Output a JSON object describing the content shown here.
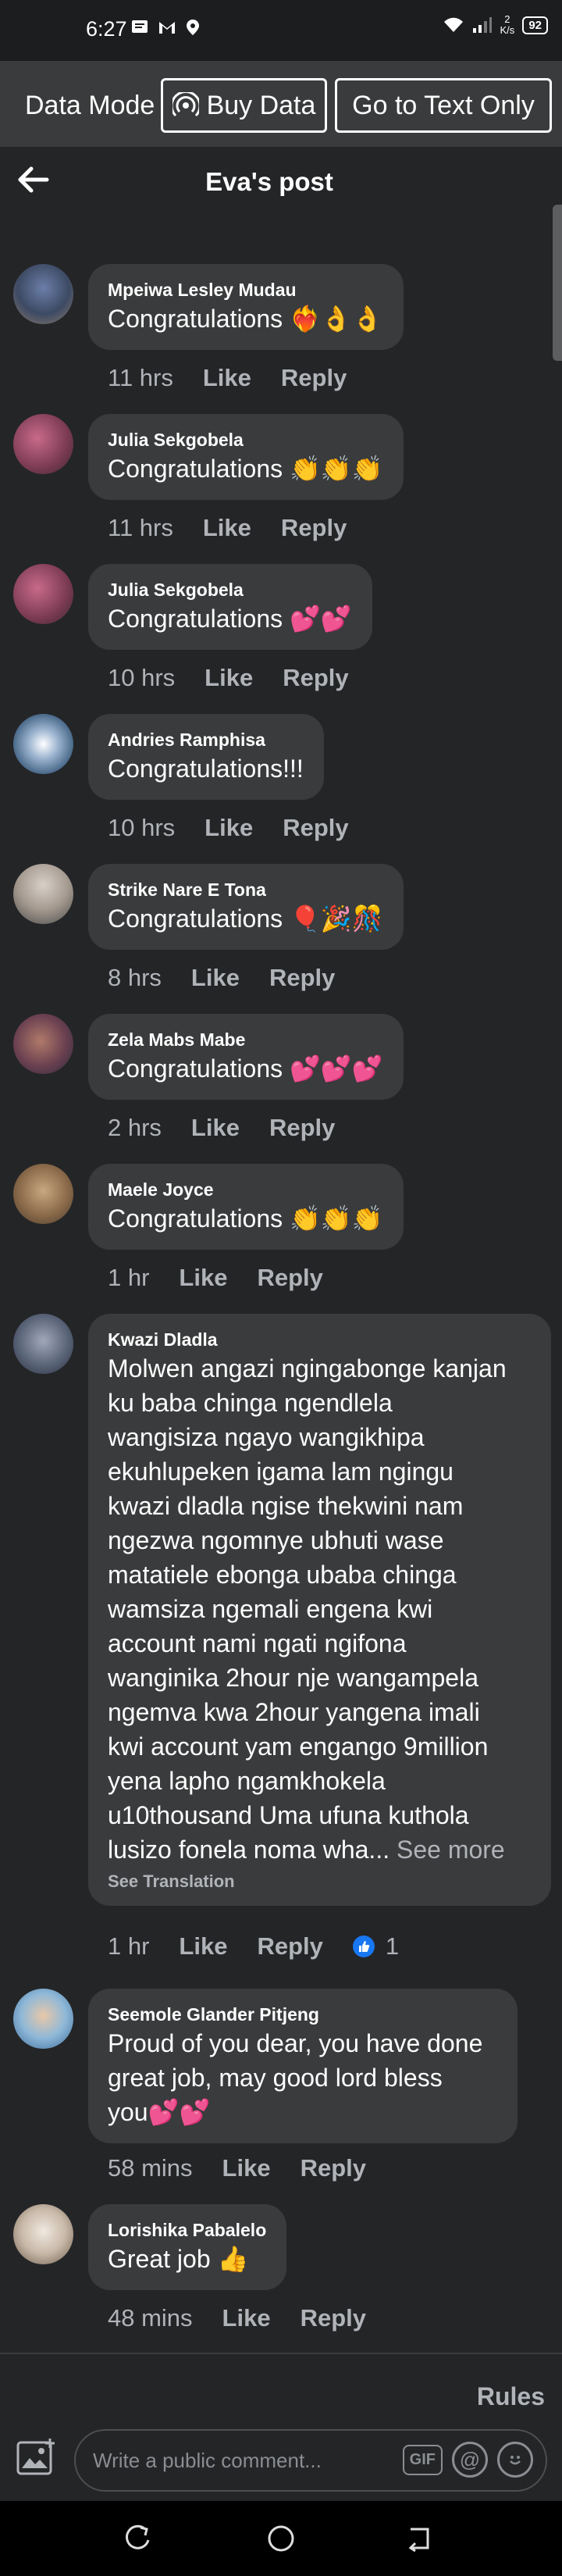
{
  "status_bar": {
    "time": "6:27",
    "net_speed_value": "2",
    "net_speed_unit": "K/s",
    "battery": "92"
  },
  "data_bar": {
    "label": "Data Mode",
    "buy_data": "Buy Data",
    "text_only": "Go to Text Only"
  },
  "header": {
    "title": "Eva's post"
  },
  "actions": {
    "like": "Like",
    "reply": "Reply"
  },
  "comments": [
    {
      "author": "Mpeiwa Lesley Mudau",
      "text": "Congratulations ❤️‍🔥👌👌",
      "time": "11 hrs"
    },
    {
      "author": "Julia Sekgobela",
      "text": "Congratulations 👏👏👏",
      "time": "11 hrs"
    },
    {
      "author": "Julia Sekgobela",
      "text": "Congratulations 💕💕",
      "time": "10 hrs"
    },
    {
      "author": "Andries Ramphisa",
      "text": "Congratulations!!!",
      "time": "10 hrs"
    },
    {
      "author": "Strike Nare E Tona",
      "text": "Congratulations 🎈🎉🎊",
      "time": "8 hrs"
    },
    {
      "author": "Zela Mabs Mabe",
      "text": "Congratulations 💕💕💕",
      "time": "2 hrs"
    },
    {
      "author": "Maele Joyce",
      "text": "Congratulations 👏👏👏",
      "time": "1 hr"
    },
    {
      "author": "Kwazi Dladla",
      "text": "Molwen angazi ngingabonge kanjan\nku baba chinga ngendlela\nwangisiza ngayo wangikhipa\nekuhlupeken igama lam ngingu\nkwazi dladla ngise thekwini nam\nngezwa ngomnye ubhuti wase\nmatatiele ebonga ubaba chinga\nwamsiza ngemali engena kwi\naccount nami ngati ngifona\nwanginika 2hour nje wangampela\nngemva kwa 2hour yangena imali\nkwi account yam engango 9million\nyena lapho ngamkhokela\nu10thousand Uma ufuna kuthola\nlusizo fonela noma wha...",
      "see_more": " See more",
      "see_translation": "See Translation",
      "time": "1 hr",
      "like_count": "1"
    },
    {
      "author": "Seemole Glander Pitjeng",
      "text": "Proud of you dear, you have done\ngreat job, may good lord bless\nyou💕💕",
      "time": "58 mins"
    },
    {
      "author": "Lorishika Pabalelo",
      "text": "Great job 👍",
      "time": "48 mins"
    }
  ],
  "footer": {
    "rules": "Rules",
    "comment_placeholder": "Write a public comment...",
    "gif": "GIF"
  },
  "colors": {
    "background": "#242527",
    "bubble": "#3a3b3c",
    "accent": "#1877f2"
  }
}
